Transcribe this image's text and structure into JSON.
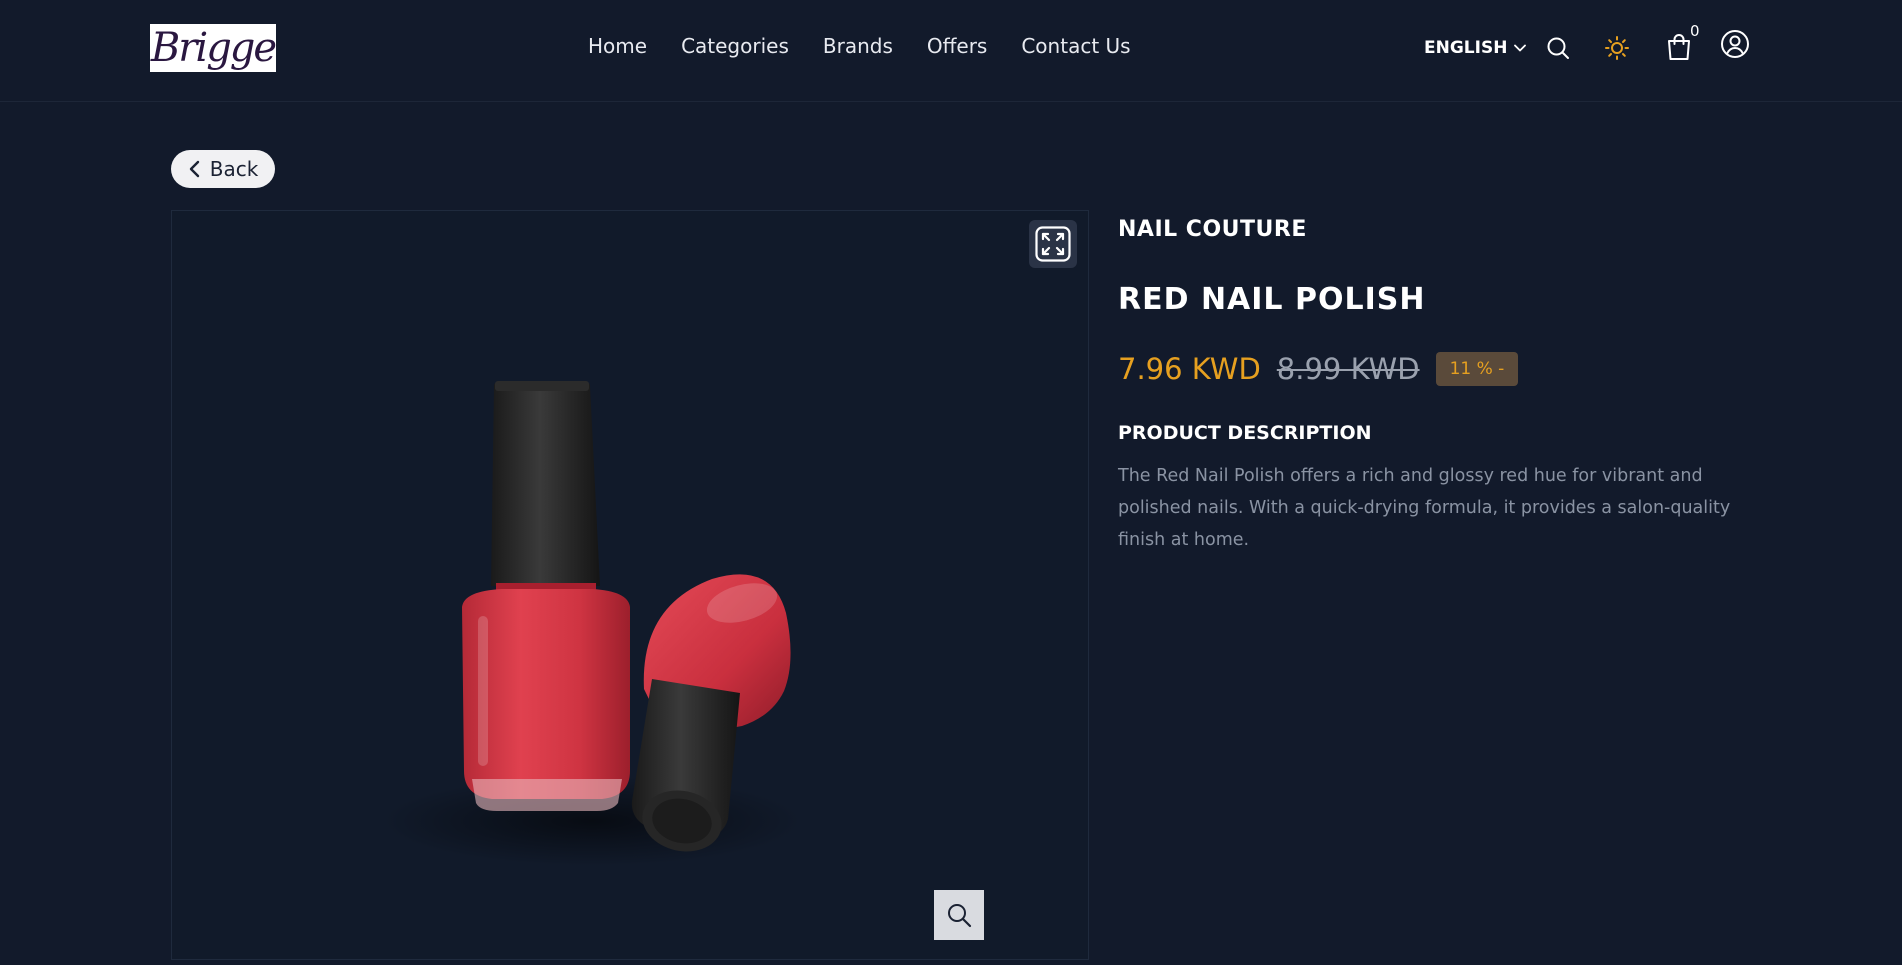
{
  "header": {
    "logo_text": "Brigge",
    "nav": [
      "Home",
      "Categories",
      "Brands",
      "Offers",
      "Contact Us"
    ],
    "language": "ENGLISH",
    "cart_count": "0",
    "icons": {
      "language_chevron": "chevron-down-icon",
      "search": "search-icon",
      "theme": "sun-icon",
      "cart": "shopping-bag-icon",
      "account": "user-circle-icon"
    }
  },
  "back_label": "Back",
  "product": {
    "brand": "NAIL COUTURE",
    "title": "RED NAIL POLISH",
    "price": "7.96 KWD",
    "original_price": "8.99 KWD",
    "discount": "11 % -",
    "description_heading": "PRODUCT DESCRIPTION",
    "description": "The Red Nail Polish offers a rich and glossy red hue for vibrant and polished nails. With a quick-drying formula, it provides a salon-quality finish at home."
  },
  "colors": {
    "background": "#121a2b",
    "accent_price": "#e6a020",
    "muted_text": "#8a93a3",
    "polish_red": "#d43a47"
  }
}
